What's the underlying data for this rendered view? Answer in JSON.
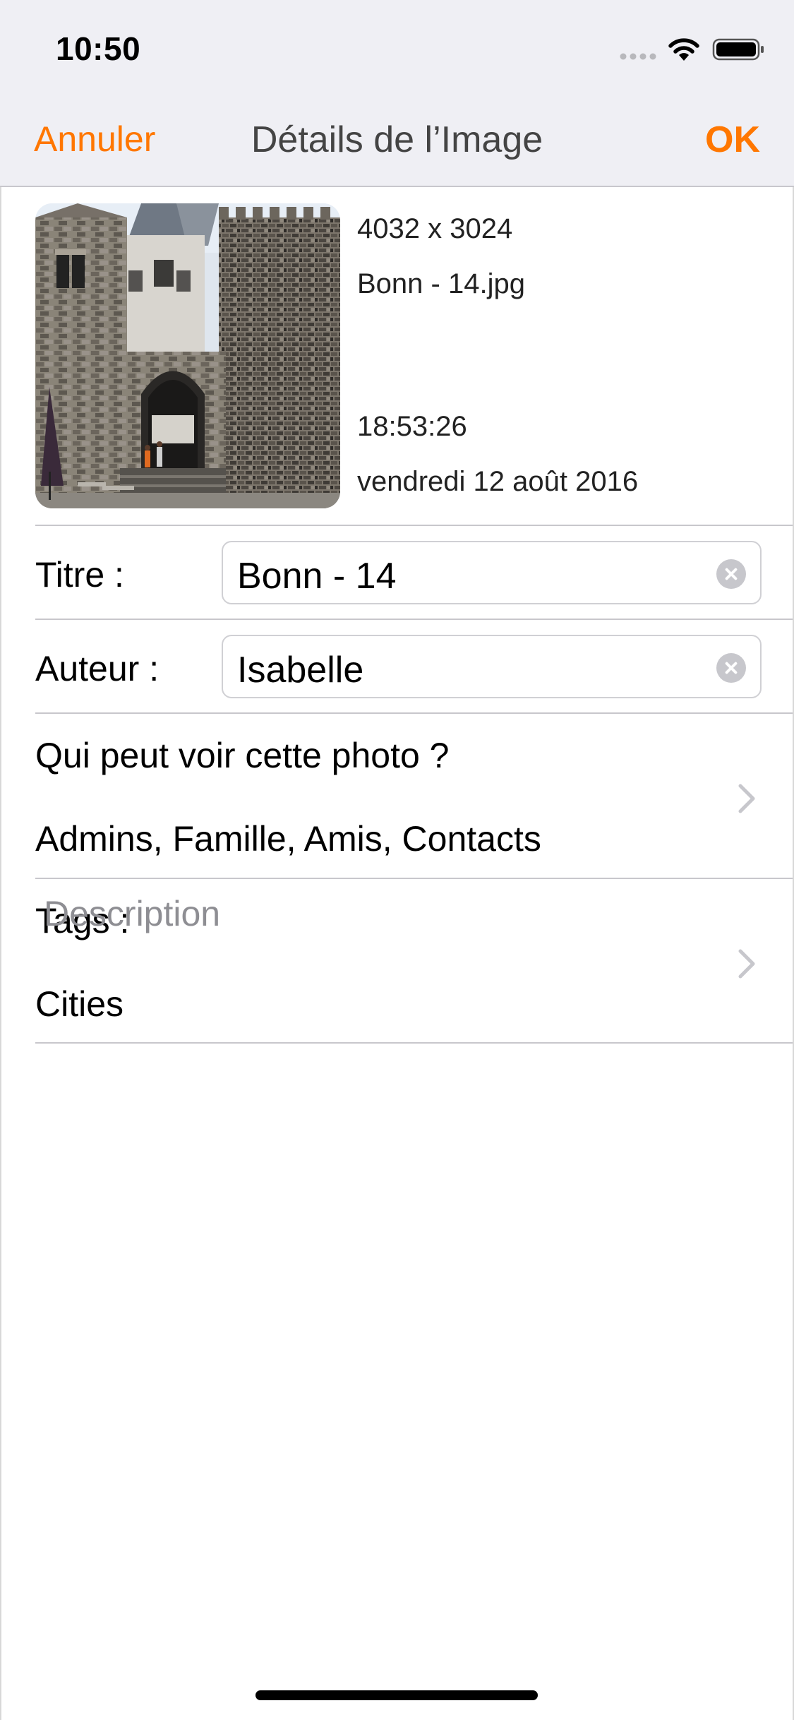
{
  "status_bar": {
    "time": "10:50"
  },
  "nav": {
    "cancel_label": "Annuler",
    "title": "Détails de l’Image",
    "ok_label": "OK"
  },
  "image": {
    "dimensions": "4032 x 3024",
    "filename": "Bonn - 14.jpg",
    "time": "18:53:26",
    "date": "vendredi 12 août 2016"
  },
  "fields": {
    "title_label": "Titre :",
    "title_value": "Bonn - 14",
    "author_label": "Auteur :",
    "author_value": "Isabelle"
  },
  "privacy": {
    "label": "Qui peut voir cette photo ?",
    "value": "Admins, Famille, Amis, Contacts"
  },
  "tags": {
    "label": "Tags :",
    "value": "Cities"
  },
  "description": {
    "placeholder": "Description"
  },
  "colors": {
    "accent": "#ff7700",
    "bar_background": "#efeff4",
    "separator": "#c8c7cc"
  },
  "icons": {
    "signal": "cellular-signal-icon",
    "wifi": "wifi-icon",
    "battery": "battery-icon",
    "clear": "clear-field-icon",
    "chevron": "chevron-right-icon"
  }
}
